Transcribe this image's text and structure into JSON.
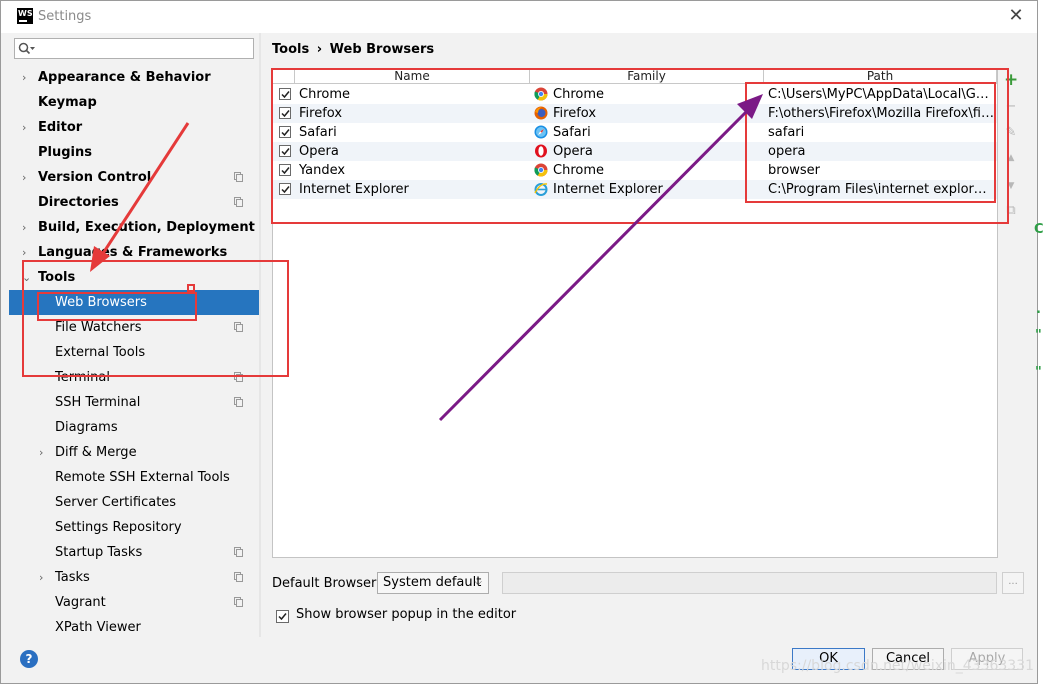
{
  "window": {
    "title": "Settings",
    "app_icon_text": "WS",
    "close_symbol": "✕"
  },
  "sidebar": {
    "search_placeholder": "",
    "items": [
      {
        "label": "Appearance & Behavior",
        "bold": true,
        "arrow": "›",
        "page_icon": false
      },
      {
        "label": "Keymap",
        "bold": true,
        "arrow": "",
        "page_icon": false
      },
      {
        "label": "Editor",
        "bold": true,
        "arrow": "›",
        "page_icon": false
      },
      {
        "label": "Plugins",
        "bold": true,
        "arrow": "",
        "page_icon": false
      },
      {
        "label": "Version Control",
        "bold": true,
        "arrow": "›",
        "page_icon": true
      },
      {
        "label": "Directories",
        "bold": true,
        "arrow": "",
        "page_icon": true
      },
      {
        "label": "Build, Execution, Deployment",
        "bold": true,
        "arrow": "›",
        "page_icon": false
      },
      {
        "label": "Languages & Frameworks",
        "bold": true,
        "arrow": "›",
        "page_icon": false
      },
      {
        "label": "Tools",
        "bold": true,
        "arrow": "⌄",
        "page_icon": false
      },
      {
        "label": "Web Browsers",
        "bold": false,
        "arrow": "",
        "page_icon": false,
        "selected": true
      },
      {
        "label": "File Watchers",
        "bold": false,
        "arrow": "",
        "page_icon": true
      },
      {
        "label": "External Tools",
        "bold": false,
        "arrow": "",
        "page_icon": false
      },
      {
        "label": "Terminal",
        "bold": false,
        "arrow": "",
        "page_icon": true
      },
      {
        "label": "SSH Terminal",
        "bold": false,
        "arrow": "",
        "page_icon": true
      },
      {
        "label": "Diagrams",
        "bold": false,
        "arrow": "",
        "page_icon": false
      },
      {
        "label": "Diff & Merge",
        "bold": false,
        "arrow": "›",
        "page_icon": false
      },
      {
        "label": "Remote SSH External Tools",
        "bold": false,
        "arrow": "",
        "page_icon": false
      },
      {
        "label": "Server Certificates",
        "bold": false,
        "arrow": "",
        "page_icon": false
      },
      {
        "label": "Settings Repository",
        "bold": false,
        "arrow": "",
        "page_icon": false
      },
      {
        "label": "Startup Tasks",
        "bold": false,
        "arrow": "",
        "page_icon": true
      },
      {
        "label": "Tasks",
        "bold": false,
        "arrow": "›",
        "page_icon": true
      },
      {
        "label": "Vagrant",
        "bold": false,
        "arrow": "",
        "page_icon": true
      },
      {
        "label": "XPath Viewer",
        "bold": false,
        "arrow": "",
        "page_icon": false
      }
    ]
  },
  "breadcrumb": {
    "parent": "Tools",
    "separator": "›",
    "current": "Web Browsers"
  },
  "browsers_table": {
    "headers": {
      "name": "Name",
      "family": "Family",
      "path": "Path"
    },
    "rows": [
      {
        "checked": true,
        "name": "Chrome",
        "family": "Chrome",
        "family_icon": "chrome-icon",
        "path": "C:\\Users\\MyPC\\AppData\\Local\\Google\\Chrome\\Application\\chrome.exe"
      },
      {
        "checked": true,
        "name": "Firefox",
        "family": "Firefox",
        "family_icon": "firefox-icon",
        "path": "F:\\others\\Firefox\\Mozilla Firefox\\firefox.exe"
      },
      {
        "checked": true,
        "name": "Safari",
        "family": "Safari",
        "family_icon": "safari-icon",
        "path": "safari"
      },
      {
        "checked": true,
        "name": "Opera",
        "family": "Opera",
        "family_icon": "opera-icon",
        "path": "opera"
      },
      {
        "checked": true,
        "name": "Yandex",
        "family": "Chrome",
        "family_icon": "chrome-icon",
        "path": "browser"
      },
      {
        "checked": true,
        "name": "Internet Explorer",
        "family": "Internet Explorer",
        "family_icon": "ie-icon",
        "path": "C:\\Program Files\\internet explorer\\iexplore.exe"
      }
    ]
  },
  "table_tools": {
    "add": "+",
    "remove": "−",
    "edit": "✎",
    "up": "▲",
    "down": "▼",
    "copy": "⧉"
  },
  "default_browser": {
    "label": "Default Browser:",
    "selected": "System default",
    "path_value": "",
    "browse_label": "..."
  },
  "popup_option": {
    "label": "Show browser popup in the editor",
    "checked": true
  },
  "buttons": {
    "help": "?",
    "ok": "OK",
    "cancel": "Cancel",
    "apply": "Apply"
  },
  "watermark": "https://blog.csdn.net/weixin_43363331",
  "colors": {
    "selection": "#2675bf",
    "annotation_red": "#e53a3a",
    "annotation_purple": "#7b1a86"
  }
}
